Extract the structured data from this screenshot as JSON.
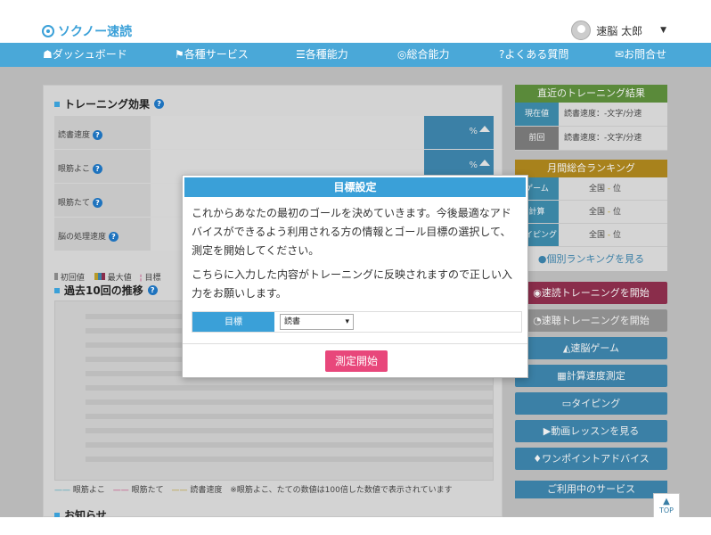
{
  "header": {
    "logo": "ソクノー速読",
    "user_name": "速脳 太郎"
  },
  "nav": [
    {
      "icon": "home-icon",
      "glyph": "☗",
      "label": "ダッシュボード"
    },
    {
      "icon": "flag-icon",
      "glyph": "⚑",
      "label": "各種サービス"
    },
    {
      "icon": "list-icon",
      "glyph": "☰",
      "label": "各種能力"
    },
    {
      "icon": "target-icon",
      "glyph": "◎",
      "label": "総合能力"
    },
    {
      "icon": "question-icon",
      "glyph": "?",
      "label": "よくある質問"
    },
    {
      "icon": "mail-icon",
      "glyph": "✉",
      "label": "お問合せ"
    }
  ],
  "training_effect": {
    "title": "トレーニング効果",
    "rows": [
      {
        "label": "読書速度",
        "value": "%"
      },
      {
        "label": "眼筋よこ",
        "value": "%"
      },
      {
        "label": "眼筋たて",
        "value": "%"
      },
      {
        "label": "脳の処理速度",
        "value": "%"
      }
    ],
    "legend": {
      "initial": "初回値",
      "max": "最大値",
      "goal": "目標"
    }
  },
  "history": {
    "title": "過去10回の推移",
    "legend": [
      {
        "label": "眼筋よこ",
        "color": "#3a9fb5"
      },
      {
        "label": "眼筋たて",
        "color": "#c0427a"
      },
      {
        "label": "読書速度",
        "color": "#b69a2a"
      }
    ],
    "note": "※眼筋よこ、たての数値は100倍した数値で表示されています"
  },
  "notice_title": "お知らせ",
  "recent": {
    "title": "直近のトレーニング結果",
    "rows": [
      {
        "tag": "現在値",
        "text": "読書速度：-文字/分速"
      },
      {
        "tag": "前回",
        "text": "読書速度：-文字/分速"
      }
    ]
  },
  "ranking": {
    "title": "月間総合ランキング",
    "rows": [
      {
        "tag": "ゲーム",
        "prefix": "全国",
        "pos": "-",
        "suffix": "位"
      },
      {
        "tag": "計算",
        "prefix": "全国",
        "pos": "-",
        "suffix": "位"
      },
      {
        "tag": "タイピング",
        "prefix": "全国",
        "pos": "-",
        "suffix": "位"
      }
    ],
    "link": "個別ランキングを見る"
  },
  "side_buttons": [
    {
      "label": "速読トレーニングを開始",
      "color": "#8a2d4b",
      "icon": "play-icon"
    },
    {
      "label": "速聴トレーニングを開始",
      "color": "#8f8f8f",
      "icon": "ear-icon"
    },
    {
      "label": "速脳ゲーム",
      "color": "#3b80a6",
      "icon": "game-icon"
    },
    {
      "label": "計算速度測定",
      "color": "#3b80a6",
      "icon": "calculator-icon"
    },
    {
      "label": "タイピング",
      "color": "#3b80a6",
      "icon": "keyboard-icon"
    },
    {
      "label": "動画レッスンを見る",
      "color": "#3b80a6",
      "icon": "video-icon"
    },
    {
      "label": "ワンポイントアドバイス",
      "color": "#3b80a6",
      "icon": "bulb-icon"
    }
  ],
  "services_title": "ご利用中のサービス",
  "top_button": "TOP",
  "modal": {
    "title": "目標設定",
    "paragraph1": "これからあなたの最初のゴールを決めていきます。今後最適なアドバイスができるよう利用される方の情報とゴール目標の選択して、測定を開始してください。",
    "paragraph2": "こちらに入力した内容がトレーニングに反映されますので正しい入力をお願いします。",
    "target_label": "目標",
    "target_value": "読書",
    "start_button": "測定開始"
  }
}
